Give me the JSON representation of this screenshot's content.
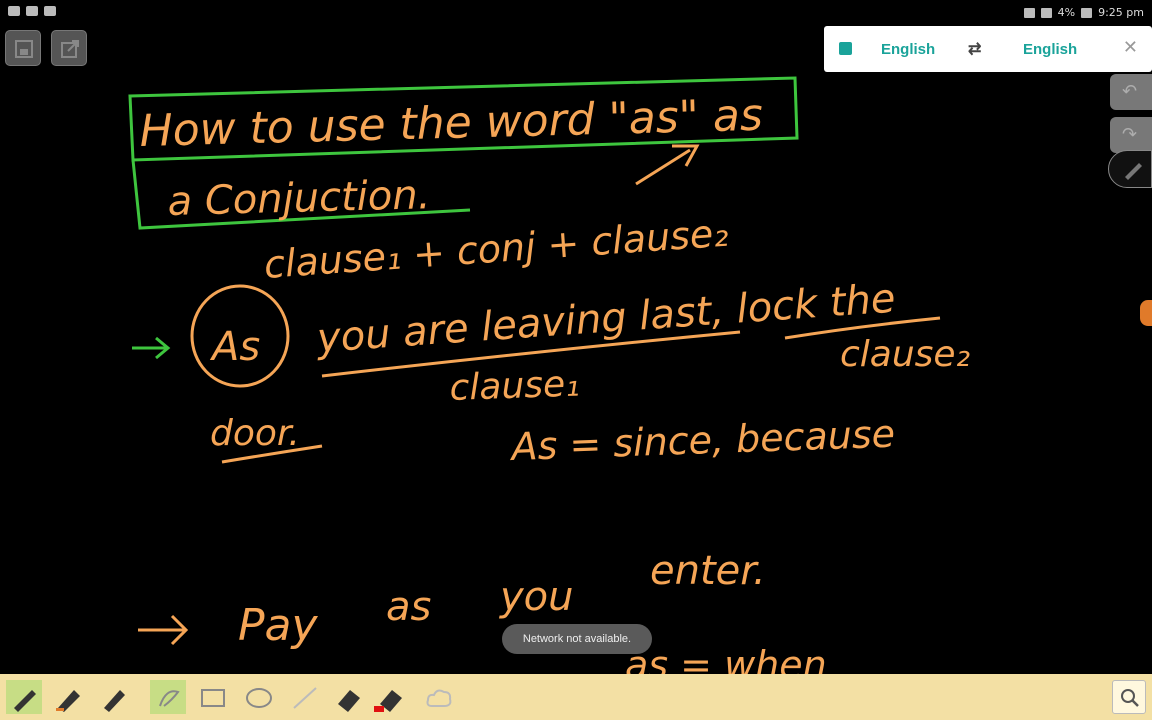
{
  "status_bar": {
    "battery": "4%",
    "time": "9:25 pm"
  },
  "translator": {
    "source_language": "English",
    "target_language": "English",
    "swap_icon": "swap-arrows-icon",
    "close_icon": "close-icon"
  },
  "board": {
    "title_line1": "How to use the word \"as\" as",
    "title_line2": "a Conjuction.",
    "formula": "clause₁ + conj + clause₂",
    "example1_word": "As",
    "example1_rest": "you are leaving last, lock the",
    "example1_end": "door.",
    "label_clause1": "clause₁",
    "label_clause2": "clause₂",
    "meaning1": "As = since, because",
    "example2_a": "Pay",
    "example2_b": "as",
    "example2_c": "you",
    "example2_d": "enter.",
    "meaning2": "as = when"
  },
  "toast": "Network not available.",
  "toolbar": {
    "tools": [
      "pen",
      "marker",
      "brush",
      "lasso",
      "rectangle",
      "ellipse",
      "line",
      "eraser",
      "eraser-red",
      "cloud"
    ],
    "search_icon": "search-icon"
  },
  "colors": {
    "ink": "#f5a556",
    "box": "#3ec53e",
    "accent": "#1aa39a",
    "toolbar_bg": "#f3e0a4"
  }
}
